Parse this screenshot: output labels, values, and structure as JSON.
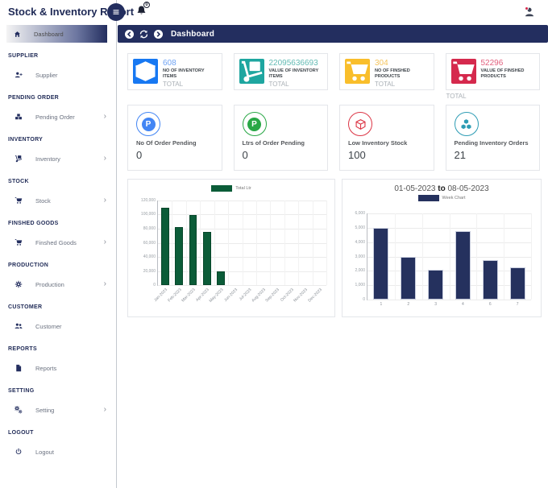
{
  "app": {
    "title": "Stock & Inventory Report",
    "notifications_count": "0"
  },
  "topbar": {
    "title": "Dashboard",
    "back_icon": "arrow-left-circle",
    "refresh_icon": "refresh",
    "forward_icon": "arrow-right-circle"
  },
  "sidebar": {
    "active_label": "Dashboard",
    "active_icon": "home",
    "sections": [
      {
        "header": "SUPPLIER",
        "item": "Supplier",
        "icon": "user-plus",
        "chevron": false
      },
      {
        "header": "PENDING ORDER",
        "item": "Pending Order",
        "icon": "boxes",
        "chevron": true
      },
      {
        "header": "INVENTORY",
        "item": "Inventory",
        "icon": "dolly",
        "chevron": true
      },
      {
        "header": "STOCK",
        "item": "Stock",
        "icon": "cart",
        "chevron": true
      },
      {
        "header": "FINSHED GOODS",
        "item": "Finshed Goods",
        "icon": "cart",
        "chevron": true
      },
      {
        "header": "PRODUCTION",
        "item": "Production",
        "icon": "cog",
        "chevron": true
      },
      {
        "header": "CUSTOMER",
        "item": "Customer",
        "icon": "users",
        "chevron": false
      },
      {
        "header": "REPORTS",
        "item": "Reports",
        "icon": "file",
        "chevron": false
      },
      {
        "header": "SETTING",
        "item": "Setting",
        "icon": "cogs",
        "chevron": true
      },
      {
        "header": "LOGOUT",
        "item": "Logout",
        "icon": "power",
        "chevron": false
      }
    ]
  },
  "stat_cards": [
    {
      "value": "608",
      "label": "NO OF INVENTORY ITEMS",
      "sub": "TOTAL",
      "icon": "box",
      "color": "#1778F2",
      "value_color": "#6FA3F4"
    },
    {
      "value": "22095636693",
      "label": "VALUE OF INVENTORY ITEMS",
      "sub": "TOTAL",
      "icon": "dolly",
      "color": "#1EA6A0",
      "value_color": "#63BBB4"
    },
    {
      "value": "304",
      "label": "NO OF FINSHED PRODUCTS",
      "sub": "TOTAL",
      "icon": "cart",
      "color": "#F9BE2B",
      "value_color": "#F5C45C"
    },
    {
      "value": "52296",
      "label": "VALUE OF FINSHED PRODUCTS",
      "sub": "TOTAL",
      "icon": "cart",
      "color": "#D5294D",
      "value_color": "#E2607E"
    }
  ],
  "summary_cards": [
    {
      "label": "No Of Order Pending",
      "value": "0",
      "icon": "p-circle",
      "letter": "P",
      "color": "#4285F4"
    },
    {
      "label": "Ltrs of Order Pending",
      "value": "0",
      "icon": "p-circle",
      "letter": "P",
      "color": "#28A745"
    },
    {
      "label": "Low Inventory Stock",
      "value": "100",
      "icon": "cube-outline",
      "color": "#DC3545"
    },
    {
      "label": "Pending Inventory Orders",
      "value": "21",
      "icon": "cubes",
      "color": "#2D9CB4"
    }
  ],
  "chart_data": [
    {
      "type": "bar",
      "legend": "Total Ltr",
      "categories": [
        "Jan-2023",
        "Feb-2023",
        "Mar-2023",
        "Apr-2023",
        "May-2023",
        "Jun-2023",
        "Jul-2023",
        "Aug-2023",
        "Sep-2023",
        "Oct-2023",
        "Nov-2023",
        "Dec-2023"
      ],
      "values": [
        110000,
        82000,
        100000,
        76000,
        20000,
        0,
        0,
        0,
        0,
        0,
        0,
        0
      ],
      "ylim": [
        0,
        120000
      ],
      "yticks": [
        "120,000",
        "100,000",
        "80,000",
        "60,000",
        "40,000",
        "20,000",
        "0"
      ],
      "bar_color": "#0B5C38",
      "bar_border": "#07462A",
      "xlabel_rotated": true,
      "grid": true,
      "legend_position": "top"
    },
    {
      "type": "bar",
      "title": {
        "start": "01-05-2023",
        "mid": "to",
        "end": "08-05-2023"
      },
      "legend": "Week Chart",
      "categories": [
        "1",
        "2",
        "3",
        "4",
        "6",
        "7"
      ],
      "values": [
        5000,
        3000,
        2100,
        4750,
        2750,
        2250
      ],
      "ylim": [
        0,
        6000
      ],
      "yticks": [
        "6,000",
        "5,000",
        "4,000",
        "3,000",
        "2,000",
        "1,000",
        "0"
      ],
      "bar_color": "#25315E",
      "bar_border": "#C9CEDE",
      "xlabel_rotated": false,
      "grid": true,
      "legend_position": "top"
    }
  ]
}
